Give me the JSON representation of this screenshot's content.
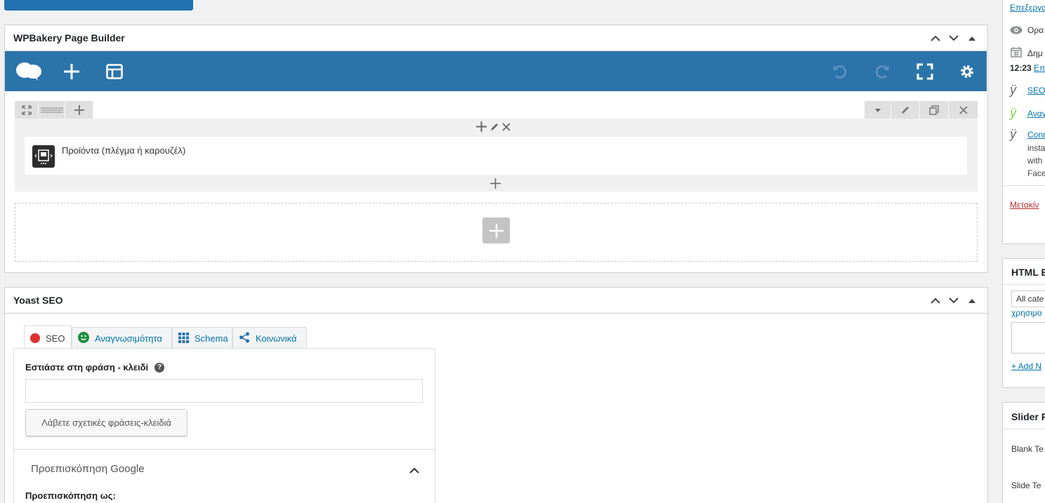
{
  "wpbakery": {
    "title": "WPBakery Page Builder",
    "element_name": "Προϊόντα (πλέγμα ή καρουζέλ)"
  },
  "yoast": {
    "title": "Yoast SEO",
    "tabs": [
      {
        "label": "SEO"
      },
      {
        "label": "Αναγνωσιμότητα"
      },
      {
        "label": "Schema"
      },
      {
        "label": "Κοινωνικά"
      }
    ],
    "focus_label": "Εστιάστε στη φράση - κλειδί",
    "focus_value": "",
    "related_button": "Λάβετε σχετικές φράσεις-κλειδιά",
    "google_preview": "Προεπισκόπηση Google",
    "preview_as": "Προεπισκόπηση ως:"
  },
  "sidebar": {
    "edit_link": "Επεξεργα",
    "visibility": "Ορα",
    "publish_date": "Δημ",
    "time": "12:23",
    "edit_time_link": "Επ",
    "seo_link": "SEO:",
    "readability_link": "Αναγ",
    "conn_link": "Conn",
    "conn_text1": "insta",
    "conn_text2": "with",
    "conn_text3": "Face",
    "trash_link": "Μετακίν",
    "html_box_title": "HTML B",
    "all_categories": "All cate",
    "used_link": "χρησιμο",
    "add_link": "+ Add N",
    "slider_title": "Slider R",
    "blank_template": "Blank Te",
    "slide_template": "Slide Te"
  },
  "colors": {
    "wpb_blue": "#2b74aa",
    "seo_red": "#dc3232",
    "good_green": "#1e8e3e",
    "link_blue": "#0073aa"
  }
}
